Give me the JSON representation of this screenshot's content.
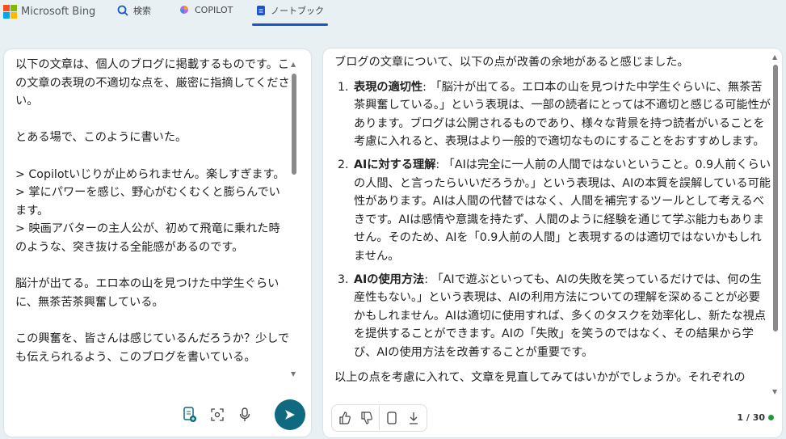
{
  "header": {
    "brand": "Microsoft Bing",
    "tabs": [
      {
        "label": "検索",
        "icon": "search-icon"
      },
      {
        "label": "COPILOT",
        "icon": "copilot-icon"
      },
      {
        "label": "ノートブック",
        "icon": "notebook-icon",
        "active": true
      }
    ]
  },
  "left": {
    "text": "以下の文章は、個人のブログに掲載するものです。この文章の表現の不適切な点を、厳密に指摘してください。\n\nとある場で、このように書いた。\n\n> Copilotいじりが止められません。楽しすぎます。\n> 掌にパワーを感じ、野心がむくむくと膨らんでいます。\n> 映画アバターの主人公が、初めて飛竜に乗れた時のような、突き抜ける全能感があるのです。\n\n脳汁が出てる。エロ本の山を見つけた中学生ぐらいに、無茶苦茶興奮している。\n\nこの興奮を、皆さんは感じているんだろうか？少しでも伝えられるよう、このブログを書いている。\n\nこういうことをしばしば耳に挟む"
  },
  "right": {
    "intro": "ブログの文章について、以下の点が改善の余地があると感じました。",
    "items": [
      {
        "title": "表現の適切性",
        "body": ": 「脳汁が出てる。エロ本の山を見つけた中学生ぐらいに、無茶苦茶興奮している。」という表現は、一部の読者にとっては不適切と感じる可能性があります。ブログは公開されるものであり、様々な背景を持つ読者がいることを考慮に入れると、表現はより一般的で適切なものにすることをおすすめします。"
      },
      {
        "title": "AIに対する理解",
        "body": ": 「AIは完全に一人前の人間ではないということ。0.9人前くらいの人間、と言ったらいいだろうか。」という表現は、AIの本質を誤解している可能性があります。AIは人間の代替ではなく、人間を補完するツールとして考えるべきです。AIは感情や意識を持たず、人間のように経験を通じて学ぶ能力もありません。そのため、AIを「0.9人前の人間」と表現するのは適切ではないかもしれません。"
      },
      {
        "title": "AIの使用方法",
        "body": ": 「AIで遊ぶといっても、AIの失敗を笑っているだけでは、何の生産性もない。」という表現は、AIの利用方法についての理解を深めることが必要かもしれません。AIは適切に使用すれば、多くのタスクを効率化し、新たな視点を提供することができます。AIの「失敗」を笑うのではなく、その結果から学び、AIの使用方法を改善することが重要です。"
      }
    ],
    "outro": "以上の点を考慮に入れて、文章を見直してみてはいかがでしょうか。それぞれの",
    "counter": "1 / 30"
  }
}
